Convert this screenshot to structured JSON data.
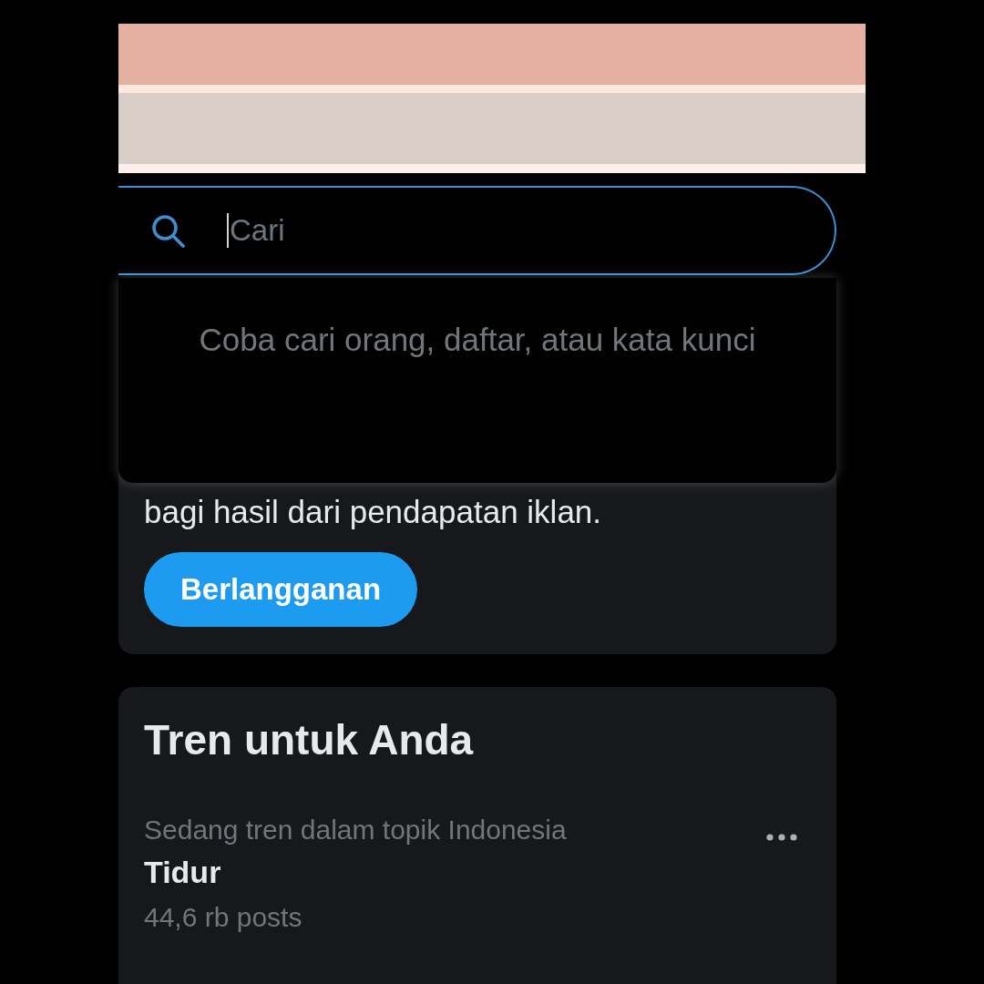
{
  "search": {
    "placeholder": "Cari",
    "focused": true
  },
  "search_dropdown": {
    "hint": "Coba cari orang, daftar, atau kata kunci"
  },
  "premium_card": {
    "text": "bagi hasil dari pendapatan iklan.",
    "button": "Berlangganan"
  },
  "trends": {
    "title": "Tren untuk Anda",
    "items": [
      {
        "context": "Sedang tren dalam topik Indonesia",
        "topic": "Tidur",
        "count": "44,6 rb posts"
      }
    ]
  }
}
